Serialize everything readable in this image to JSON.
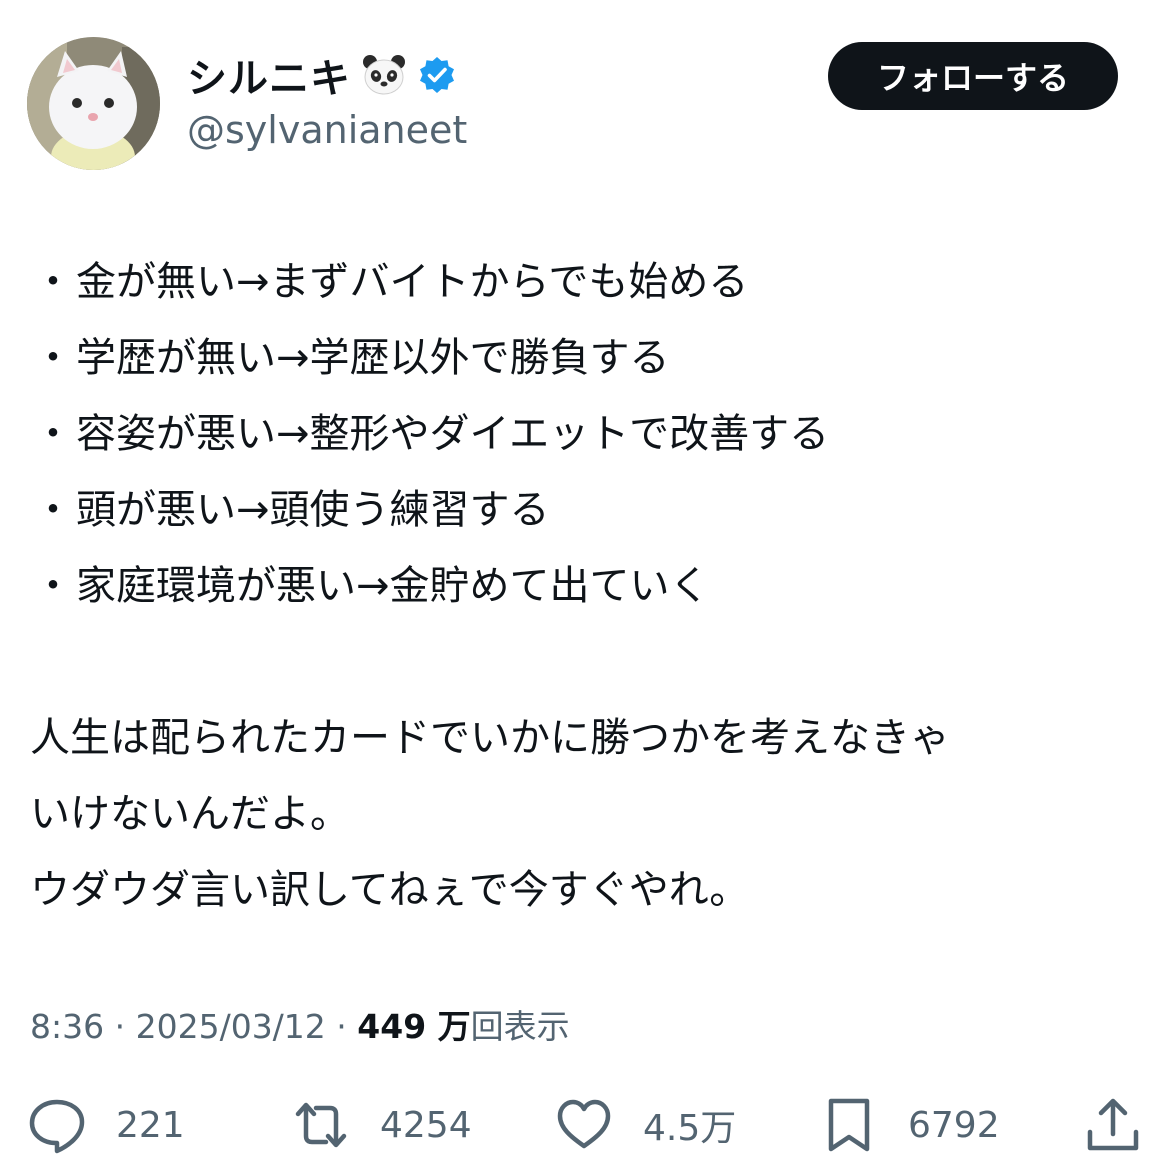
{
  "author": {
    "display_name": "シルニキ",
    "emoji": "panda-face",
    "verified": true,
    "handle": "@sylvanianeet"
  },
  "follow_button": {
    "label": "フォローする"
  },
  "tweet": {
    "bullets": [
      "金が無い→まずバイトからでも始める",
      "学歴が無い→学歴以外で勝負する",
      "容姿が悪い→整形やダイエットで改善する",
      "頭が悪い→頭使う練習する",
      "家庭環境が悪い→金貯めて出ていく"
    ],
    "bullet_mark": "・",
    "paragraph_lines": [
      "人生は配られたカードでいかに勝つかを考えなきゃ",
      "いけないんだよ。",
      "ウダウダ言い訳してねぇで今すぐやれ。"
    ]
  },
  "meta": {
    "time": "8:36",
    "separator": " · ",
    "date": "2025/03/12",
    "views_count": "449 万",
    "views_label": "回表示"
  },
  "actions": {
    "reply": {
      "icon": "reply-icon",
      "count": "221"
    },
    "repost": {
      "icon": "repost-icon",
      "count": "4254"
    },
    "like": {
      "icon": "heart-icon",
      "count": "4.5万"
    },
    "bookmark": {
      "icon": "bookmark-icon",
      "count": "6792"
    },
    "share": {
      "icon": "share-icon"
    }
  },
  "colors": {
    "text": "#0f1419",
    "secondary": "#536471",
    "verified_blue": "#1d9bf0",
    "button_bg": "#0f1419"
  }
}
